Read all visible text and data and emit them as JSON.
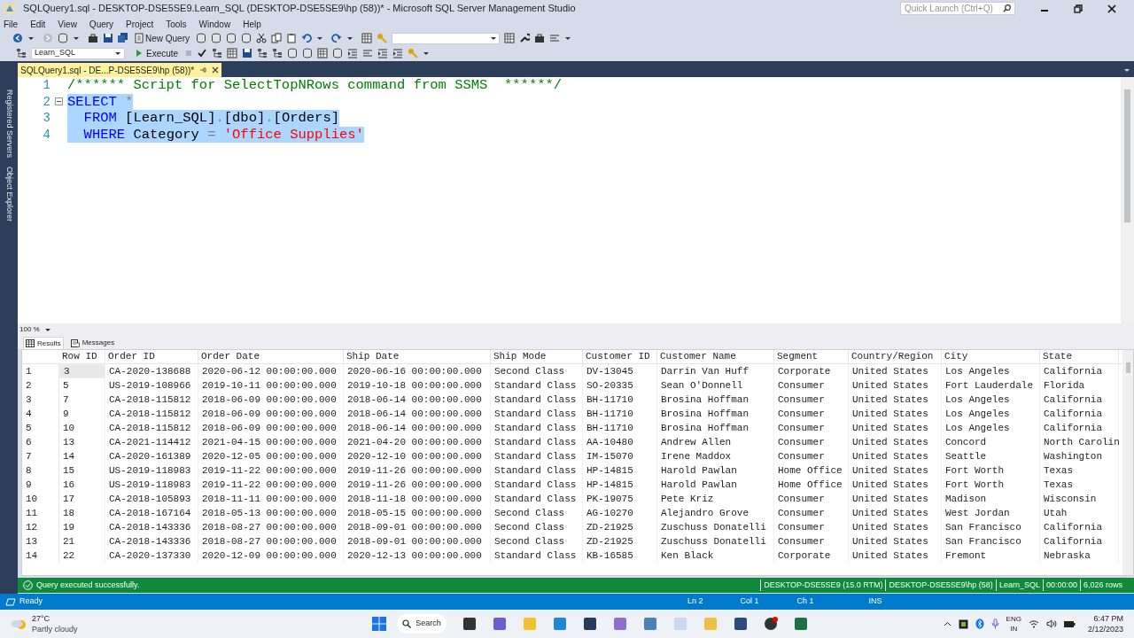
{
  "window": {
    "title": "SQLQuery1.sql - DESKTOP-DSE5SE9.Learn_SQL (DESKTOP-DSE5SE9\\hp (58))* - Microsoft SQL Server Management Studio"
  },
  "quick_launch": {
    "placeholder": "Quick Launch (Ctrl+Q)"
  },
  "menu": [
    "File",
    "Edit",
    "View",
    "Query",
    "Project",
    "Tools",
    "Window",
    "Help"
  ],
  "toolbar": {
    "new_query": "New Query",
    "database": "Learn_SQL",
    "execute": "Execute"
  },
  "side_panels": [
    "Registered Servers",
    "Object Explorer"
  ],
  "document_tab": {
    "title": "SQLQuery1.sql - DE...P-DSE5SE9\\hp (58))*",
    "selected": true
  },
  "editor": {
    "lines": [
      {
        "number": "1",
        "selected": false,
        "tokens": [
          {
            "kind": "comment",
            "text": "/****** Script for SelectTopNRows command from SSMS  ******/"
          }
        ]
      },
      {
        "number": "2",
        "selected": true,
        "tokens": [
          {
            "kind": "keyword",
            "text": "SELECT"
          },
          {
            "kind": "operator",
            "text": " *"
          }
        ]
      },
      {
        "number": "3",
        "selected": true,
        "tokens": [
          {
            "kind": "keyword",
            "text": "  FROM"
          },
          {
            "kind": "plain",
            "text": " [Learn_SQL]"
          },
          {
            "kind": "operator",
            "text": "."
          },
          {
            "kind": "plain",
            "text": "[dbo]"
          },
          {
            "kind": "operator",
            "text": "."
          },
          {
            "kind": "plain",
            "text": "[Orders]"
          }
        ]
      },
      {
        "number": "4",
        "selected": true,
        "tokens": [
          {
            "kind": "keyword",
            "text": "  WHERE"
          },
          {
            "kind": "plain",
            "text": " Category "
          },
          {
            "kind": "operator",
            "text": "="
          },
          {
            "kind": "string",
            "text": " 'Office Supplies'"
          }
        ]
      }
    ]
  },
  "zoom": "100 %",
  "result_tabs": [
    {
      "label": "Results",
      "selected": true
    },
    {
      "label": "Messages",
      "selected": false
    }
  ],
  "results": {
    "columns": [
      "Row ID",
      "Order ID",
      "Order Date",
      "Ship Date",
      "Ship Mode",
      "Customer ID",
      "Customer Name",
      "Segment",
      "Country/Region",
      "City",
      "State"
    ],
    "rows": [
      {
        "number": "1",
        "selected": true,
        "cells": [
          "3",
          "CA-2020-138688",
          "2020-06-12 00:00:00.000",
          "2020-06-16 00:00:00.000",
          "Second Class",
          "DV-13045",
          "Darrin Van Huff",
          "Corporate",
          "United States",
          "Los Angeles",
          "California"
        ]
      },
      {
        "number": "2",
        "selected": false,
        "cells": [
          "5",
          "US-2019-108966",
          "2019-10-11 00:00:00.000",
          "2019-10-18 00:00:00.000",
          "Standard Class",
          "SO-20335",
          "Sean O'Donnell",
          "Consumer",
          "United States",
          "Fort Lauderdale",
          "Florida"
        ]
      },
      {
        "number": "3",
        "selected": false,
        "cells": [
          "7",
          "CA-2018-115812",
          "2018-06-09 00:00:00.000",
          "2018-06-14 00:00:00.000",
          "Standard Class",
          "BH-11710",
          "Brosina Hoffman",
          "Consumer",
          "United States",
          "Los Angeles",
          "California"
        ]
      },
      {
        "number": "4",
        "selected": false,
        "cells": [
          "9",
          "CA-2018-115812",
          "2018-06-09 00:00:00.000",
          "2018-06-14 00:00:00.000",
          "Standard Class",
          "BH-11710",
          "Brosina Hoffman",
          "Consumer",
          "United States",
          "Los Angeles",
          "California"
        ]
      },
      {
        "number": "5",
        "selected": false,
        "cells": [
          "10",
          "CA-2018-115812",
          "2018-06-09 00:00:00.000",
          "2018-06-14 00:00:00.000",
          "Standard Class",
          "BH-11710",
          "Brosina Hoffman",
          "Consumer",
          "United States",
          "Los Angeles",
          "California"
        ]
      },
      {
        "number": "6",
        "selected": false,
        "cells": [
          "13",
          "CA-2021-114412",
          "2021-04-15 00:00:00.000",
          "2021-04-20 00:00:00.000",
          "Standard Class",
          "AA-10480",
          "Andrew Allen",
          "Consumer",
          "United States",
          "Concord",
          "North Carolin"
        ]
      },
      {
        "number": "7",
        "selected": false,
        "cells": [
          "14",
          "CA-2020-161389",
          "2020-12-05 00:00:00.000",
          "2020-12-10 00:00:00.000",
          "Standard Class",
          "IM-15070",
          "Irene Maddox",
          "Consumer",
          "United States",
          "Seattle",
          "Washington"
        ]
      },
      {
        "number": "8",
        "selected": false,
        "cells": [
          "15",
          "US-2019-118983",
          "2019-11-22 00:00:00.000",
          "2019-11-26 00:00:00.000",
          "Standard Class",
          "HP-14815",
          "Harold Pawlan",
          "Home Office",
          "United States",
          "Fort Worth",
          "Texas"
        ]
      },
      {
        "number": "9",
        "selected": false,
        "cells": [
          "16",
          "US-2019-118983",
          "2019-11-22 00:00:00.000",
          "2019-11-26 00:00:00.000",
          "Standard Class",
          "HP-14815",
          "Harold Pawlan",
          "Home Office",
          "United States",
          "Fort Worth",
          "Texas"
        ]
      },
      {
        "number": "10",
        "selected": false,
        "cells": [
          "17",
          "CA-2018-105893",
          "2018-11-11 00:00:00.000",
          "2018-11-18 00:00:00.000",
          "Standard Class",
          "PK-19075",
          "Pete Kriz",
          "Consumer",
          "United States",
          "Madison",
          "Wisconsin"
        ]
      },
      {
        "number": "11",
        "selected": false,
        "cells": [
          "18",
          "CA-2018-167164",
          "2018-05-13 00:00:00.000",
          "2018-05-15 00:00:00.000",
          "Second Class",
          "AG-10270",
          "Alejandro Grove",
          "Consumer",
          "United States",
          "West Jordan",
          "Utah"
        ]
      },
      {
        "number": "12",
        "selected": false,
        "cells": [
          "19",
          "CA-2018-143336",
          "2018-08-27 00:00:00.000",
          "2018-09-01 00:00:00.000",
          "Second Class",
          "ZD-21925",
          "Zuschuss Donatelli",
          "Consumer",
          "United States",
          "San Francisco",
          "California"
        ]
      },
      {
        "number": "13",
        "selected": false,
        "cells": [
          "21",
          "CA-2018-143336",
          "2018-08-27 00:00:00.000",
          "2018-09-01 00:00:00.000",
          "Second Class",
          "ZD-21925",
          "Zuschuss Donatelli",
          "Consumer",
          "United States",
          "San Francisco",
          "California"
        ]
      },
      {
        "number": "14",
        "selected": false,
        "cells": [
          "22",
          "CA-2020-137330",
          "2020-12-09 00:00:00.000",
          "2020-12-13 00:00:00.000",
          "Standard Class",
          "KB-16585",
          "Ken Black",
          "Corporate",
          "United States",
          "Fremont",
          "Nebraska"
        ]
      }
    ]
  },
  "query_status": {
    "message": "Query executed successfully.",
    "segments": [
      "DESKTOP-DSE5SE9 (15.0 RTM)",
      "DESKTOP-DSE5SE9\\hp (58)",
      "Learn_SQL",
      "00:00:00",
      "6,026 rows"
    ]
  },
  "status_bar": {
    "state": "Ready",
    "items": [
      "Ln 2",
      "Col 1",
      "Ch 1",
      "INS"
    ]
  },
  "taskbar": {
    "weather": {
      "temperature": "27°C",
      "condition": "Partly cloudy"
    },
    "search": "Search",
    "language": "ENG",
    "region": "IN",
    "time": "6:47 PM",
    "date": "2/12/2023"
  }
}
